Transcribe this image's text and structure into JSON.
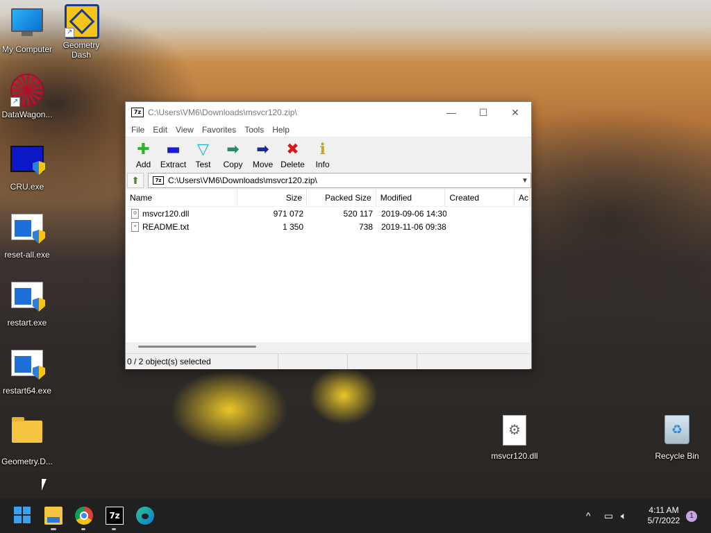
{
  "desktop": {
    "icons": [
      {
        "label": "My Computer",
        "icon": "monitor-icon"
      },
      {
        "label": "Geometry Dash",
        "icon": "geometry-dash-icon"
      },
      {
        "label": "DataWagon...",
        "icon": "datawagon-icon"
      },
      {
        "label": "CRU.exe",
        "icon": "cru-icon"
      },
      {
        "label": "reset-all.exe",
        "icon": "exe-icon"
      },
      {
        "label": "restart.exe",
        "icon": "exe-icon"
      },
      {
        "label": "restart64.exe",
        "icon": "exe-icon"
      },
      {
        "label": "Geometry.D...",
        "icon": "folder-icon"
      },
      {
        "label": "msvcr120.dll",
        "icon": "dll-file-icon"
      },
      {
        "label": "Recycle Bin",
        "icon": "recycle-bin-icon"
      }
    ]
  },
  "window": {
    "title": "C:\\Users\\VM6\\Downloads\\msvcr120.zip\\",
    "app_icon_text": "7z",
    "minimize": "—",
    "maximize": "☐",
    "close": "✕",
    "menu": [
      "File",
      "Edit",
      "View",
      "Favorites",
      "Tools",
      "Help"
    ],
    "toolbar": [
      {
        "label": "Add",
        "glyph": "✚",
        "color": "#2db52d"
      },
      {
        "label": "Extract",
        "glyph": "▬",
        "color": "#1a1ad4"
      },
      {
        "label": "Test",
        "glyph": "▽",
        "color": "#1fb3c9"
      },
      {
        "label": "Copy",
        "glyph": "➡",
        "color": "#2a8a6a"
      },
      {
        "label": "Move",
        "glyph": "➡",
        "color": "#1a2a9a"
      },
      {
        "label": "Delete",
        "glyph": "✖",
        "color": "#d41a1a"
      },
      {
        "label": "Info",
        "glyph": "ℹ",
        "color": "#c9a21a"
      }
    ],
    "address": "C:\\Users\\VM6\\Downloads\\msvcr120.zip\\",
    "columns": [
      "Name",
      "Size",
      "Packed Size",
      "Modified",
      "Created",
      "Ac"
    ],
    "rows": [
      {
        "name": "msvcr120.dll",
        "size": "971 072",
        "packed": "520 117",
        "modified": "2019-09-06 14:30",
        "created": ""
      },
      {
        "name": "README.txt",
        "size": "1 350",
        "packed": "738",
        "modified": "2019-11-06 09:38",
        "created": ""
      }
    ],
    "status": [
      "0 / 2 object(s) selected",
      "",
      "",
      ""
    ]
  },
  "taskbar": {
    "time": "4:11 AM",
    "date": "5/7/2022",
    "notification_count": "1",
    "tray_chevron": "^",
    "sz_label": "7z"
  }
}
